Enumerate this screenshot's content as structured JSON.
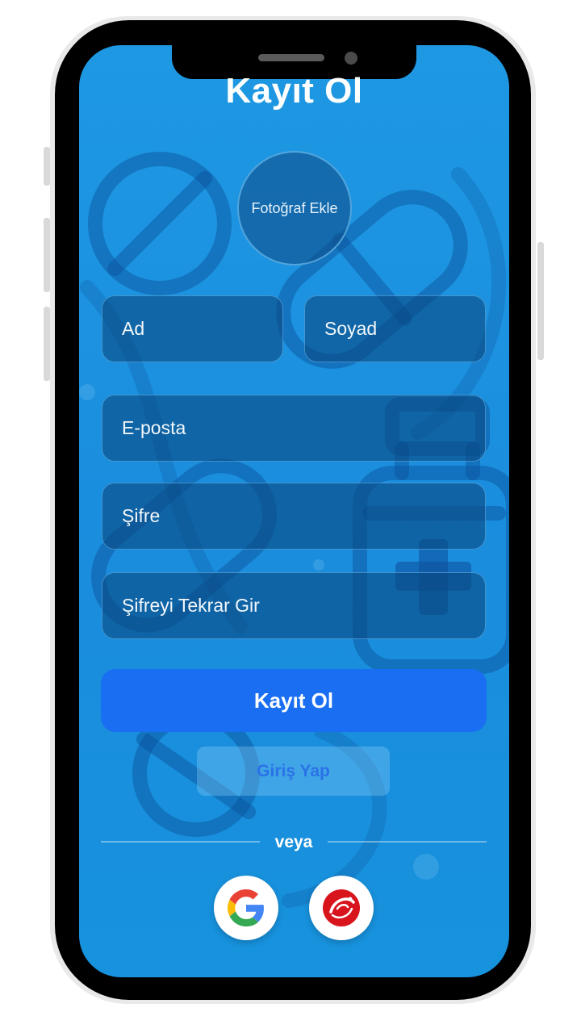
{
  "title": "Kayıt Ol",
  "photo_button_label": "Fotoğraf Ekle",
  "fields": {
    "first_name_placeholder": "Ad",
    "last_name_placeholder": "Soyad",
    "email_placeholder": "E-posta",
    "password_placeholder": "Şifre",
    "password_repeat_placeholder": "Şifreyi Tekrar Gir"
  },
  "register_button_label": "Kayıt Ol",
  "login_button_label": "Giriş Yap",
  "divider_text": "veya",
  "social": {
    "google_icon": "google-g-logo",
    "second_icon": "red-circle-brand-logo"
  },
  "colors": {
    "background": "#1e98e3",
    "primary_button": "#1a6ef2",
    "login_text": "#2a72e8"
  }
}
